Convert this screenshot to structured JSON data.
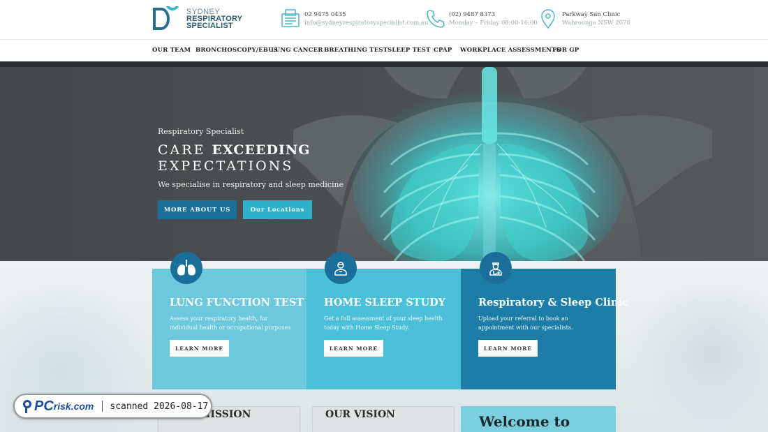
{
  "header": {
    "logo": {
      "line1": "SYDNEY",
      "line2": "RESPIRATORY",
      "line3": "SPECIALIST"
    },
    "contacts": [
      {
        "icon": "fax-icon",
        "line1": "02 9475 0435",
        "line2": "info@sydneyrespiratoryspecialist.com.au"
      },
      {
        "icon": "phone-icon",
        "line1": "(02) 9487 8373",
        "line2": "Monday – Friday 08:00-16:00"
      },
      {
        "icon": "location-pin-icon",
        "line1": "Parkway San Clinic",
        "line2": "Wahroonga NSW 2076"
      }
    ]
  },
  "nav": {
    "items": [
      "OUR TEAM",
      "BRONCHOSCOPY/EBUS",
      "LUNG CANCER",
      "BREATHING TEST",
      "SLEEP TEST",
      "CPAP",
      "WORKPLACE ASSESSMENTS",
      "FOR GP"
    ]
  },
  "hero": {
    "kicker": "Respiratory Specialist",
    "title_light": "CARE",
    "title_bold": "EXCEEDING",
    "title_line2": "EXPECTATIONS",
    "subtitle": "We specialise in respiratory and sleep medicine",
    "btn_about": "MORE ABOUT US",
    "btn_locations": "Our Locations"
  },
  "cards": [
    {
      "icon": "lungs-icon",
      "title": "LUNG FUNCTION TEST",
      "text": "Assess your respiratory health, for individual health or occupational purposes",
      "button": "LEARN MORE"
    },
    {
      "icon": "sleeping-person-icon",
      "title": "HOME SLEEP STUDY",
      "text": "Get a full assessment of your sleep health today with Home Sleep Study.",
      "button": "LEARN MORE"
    },
    {
      "icon": "doctor-icon",
      "title": "Respiratory & Sleep Clinic",
      "text": "Upload your referral to book an appointment with our specialists.",
      "button": "LEARN MORE"
    }
  ],
  "bottom": {
    "mission": "OUR MISSION",
    "vision": "OUR VISION",
    "welcome": "Welcome to"
  },
  "watermark": {
    "brand_pc": "PC",
    "brand_rest": "risk.com",
    "scanned": "scanned 2026-08-17"
  },
  "colors": {
    "primary": "#1a6f9a",
    "accent": "#2fb2c9",
    "card1": "#6cc9dd",
    "card2": "#4cc0d8",
    "card3": "#1c7ea6"
  }
}
